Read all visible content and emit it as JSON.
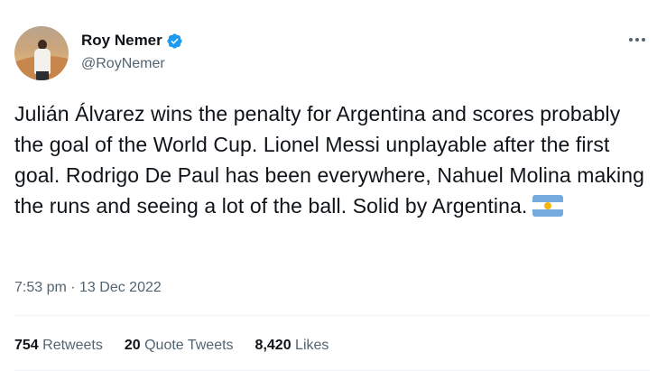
{
  "author": {
    "name": "Roy Nemer",
    "handle": "@RoyNemer",
    "verified": true,
    "verified_color": "#1d9bf0"
  },
  "tweet": {
    "text": "Julián Álvarez wins the penalty for Argentina and scores probably the goal of the World Cup. Lionel Messi unplayable after the first goal. Rodrigo De Paul has been everywhere, Nahuel Molina making the runs and seeing a lot of the ball. Solid by Argentina.",
    "emoji": "argentina-flag",
    "timestamp": "7:53 pm · 13 Dec 2022"
  },
  "stats": {
    "retweets_count": "754",
    "retweets_label": "Retweets",
    "quotes_count": "20",
    "quotes_label": "Quote Tweets",
    "likes_count": "8,420",
    "likes_label": "Likes"
  },
  "icons": [
    "verified-badge-icon",
    "more-options-icon",
    "argentina-flag-icon"
  ]
}
